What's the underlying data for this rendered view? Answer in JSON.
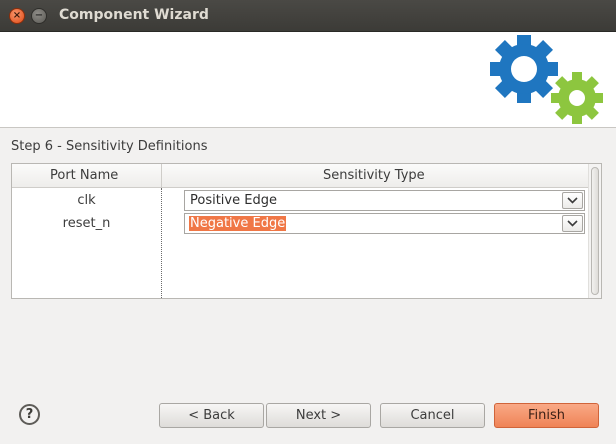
{
  "window": {
    "title": "Component Wizard",
    "close_glyph": "×",
    "minimize_glyph": "−"
  },
  "banner": {
    "icon": "gears-icon",
    "colors": {
      "blue_gear": "#1f76c0",
      "green_gear": "#8dc63f"
    }
  },
  "step": {
    "title": "Step 6 - Sensitivity Definitions"
  },
  "table": {
    "headers": {
      "port_name": "Port Name",
      "sensitivity_type": "Sensitivity Type"
    },
    "rows": [
      {
        "port": "clk",
        "sensitivity": "Positive Edge",
        "selected": false
      },
      {
        "port": "reset_n",
        "sensitivity": "Negative Edge",
        "selected": true
      }
    ]
  },
  "buttons": {
    "help": "?",
    "back": "< Back",
    "next": "Next >",
    "cancel": "Cancel",
    "finish": "Finish"
  },
  "colors": {
    "accent": "#f07746",
    "titlebar": "#3c3b37"
  }
}
